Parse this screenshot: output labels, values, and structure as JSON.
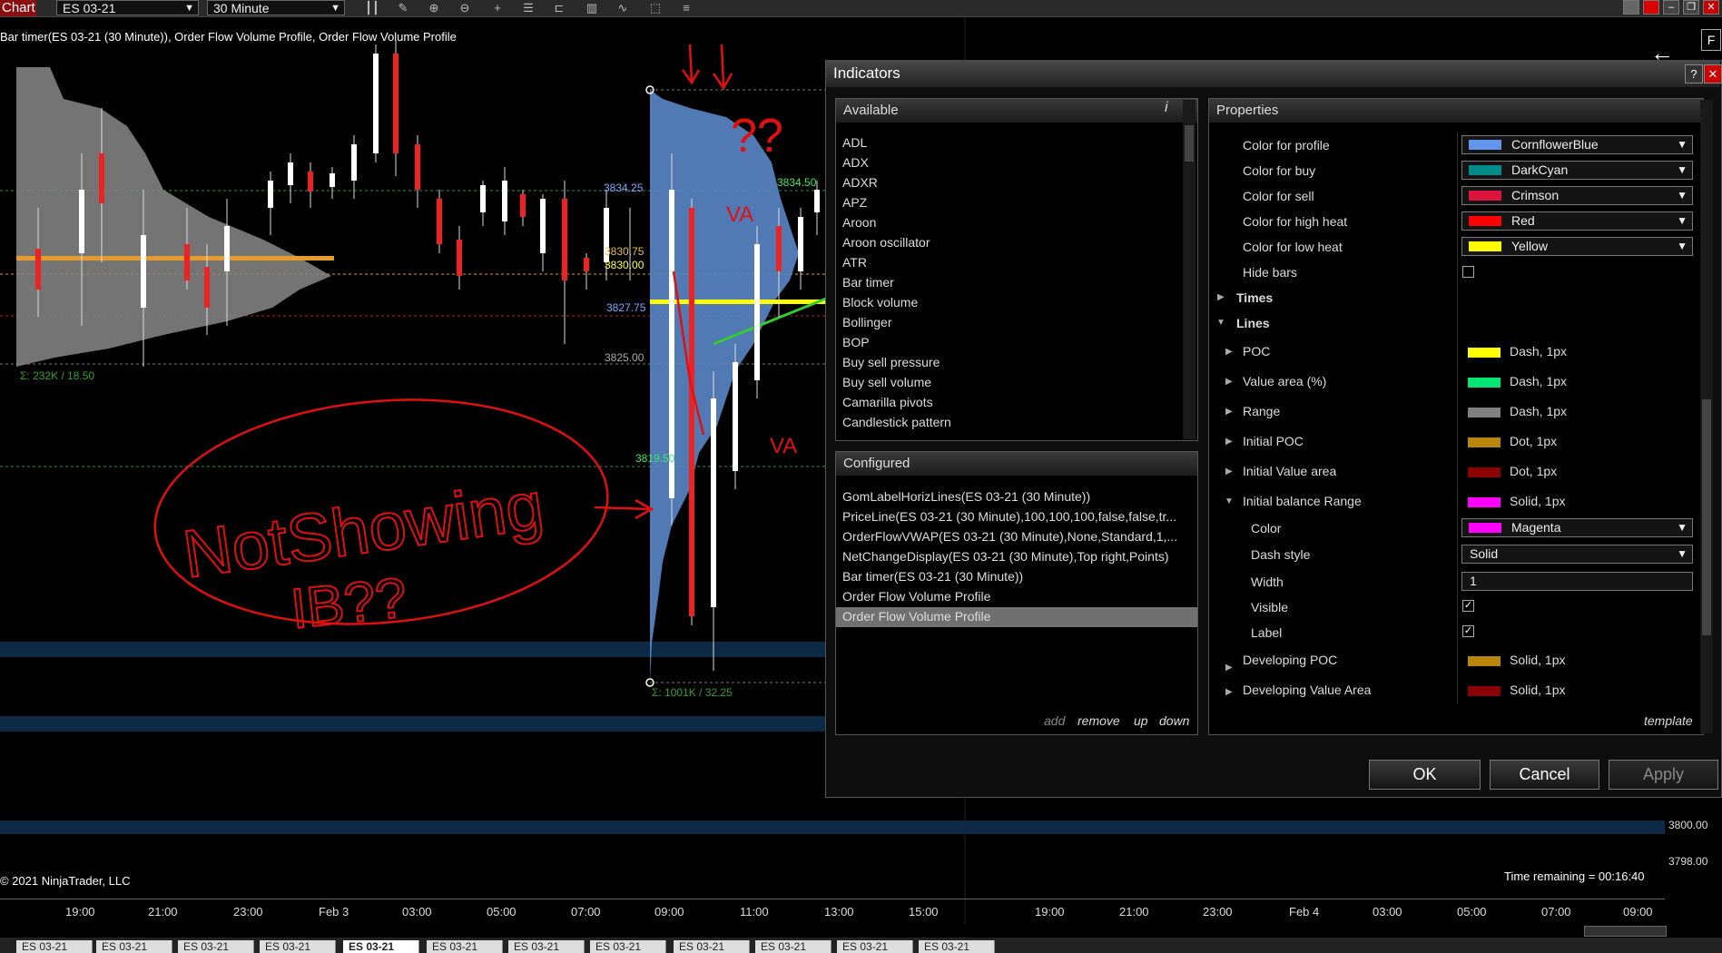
{
  "toolbar": {
    "chart_tab": "Chart",
    "instrument": "ES 03-21",
    "interval": "30 Minute"
  },
  "chart": {
    "title": "Bar timer(ES 03-21 (30 Minute)), Order Flow Volume Profile, Order Flow Volume Profile",
    "levels": {
      "l1": "3834.25",
      "l2": "3834.50",
      "l3": "3830.75",
      "l4": "3830.00",
      "l5": "3827.75",
      "l6": "3825.00",
      "l7": "3819.50"
    },
    "profile_stats_left": "Σ: 232K / 18.50",
    "profile_stats_right": "Σ: 1001K / 32.25",
    "y_ticks": [
      "3800.00",
      "3798.00"
    ],
    "x_ticks": [
      "19:00",
      "21:00",
      "23:00",
      "Feb 3",
      "03:00",
      "05:00",
      "07:00",
      "09:00",
      "11:00",
      "13:00",
      "15:00",
      "19:00",
      "21:00",
      "23:00",
      "Feb 4",
      "03:00",
      "05:00",
      "07:00",
      "09:00"
    ],
    "copyright": "© 2021 NinjaTrader, LLC",
    "time_remaining": "Time remaining = 00:16:40",
    "annotations": {
      "qq": "??",
      "va_top": "VA",
      "va_bottom": "VA",
      "not_showing": "NotShowing",
      "ib": "IB??"
    }
  },
  "dialog": {
    "title": "Indicators",
    "available_header": "Available",
    "available": [
      "ADL",
      "ADX",
      "ADXR",
      "APZ",
      "Aroon",
      "Aroon oscillator",
      "ATR",
      "Bar timer",
      "Block volume",
      "Bollinger",
      "BOP",
      "Buy sell pressure",
      "Buy sell volume",
      "Camarilla pivots",
      "Candlestick pattern"
    ],
    "configured_header": "Configured",
    "configured": [
      "GomLabelHorizLines(ES 03-21 (30 Minute))",
      "PriceLine(ES 03-21 (30 Minute),100,100,100,false,false,tr...",
      "OrderFlowVWAP(ES 03-21 (30 Minute),None,Standard,1,...",
      "NetChangeDisplay(ES 03-21 (30 Minute),Top right,Points)",
      "Bar timer(ES 03-21 (30 Minute))",
      "Order Flow Volume Profile",
      "Order Flow Volume Profile"
    ],
    "configured_links": {
      "add": "add",
      "remove": "remove",
      "up": "up",
      "down": "down"
    },
    "properties_header": "Properties",
    "colors": [
      {
        "label": "Color for profile",
        "value": "CornflowerBlue",
        "color": "#6495ED"
      },
      {
        "label": "Color for buy",
        "value": "DarkCyan",
        "color": "#008B8B"
      },
      {
        "label": "Color for sell",
        "value": "Crimson",
        "color": "#DC143C"
      },
      {
        "label": "Color for high heat",
        "value": "Red",
        "color": "#FF0000"
      },
      {
        "label": "Color for low heat",
        "value": "Yellow",
        "color": "#FFFF00"
      }
    ],
    "hide_bars": "Hide bars",
    "times": "Times",
    "lines": "Lines",
    "line_items": [
      {
        "label": "POC",
        "value": "Dash, 1px",
        "color": "#FFFF00"
      },
      {
        "label": "Value area (%)",
        "value": "Dash, 1px",
        "color": "#00E676"
      },
      {
        "label": "Range",
        "value": "Dash, 1px",
        "color": "#808080"
      },
      {
        "label": "Initial POC",
        "value": "Dot, 1px",
        "color": "#B8860B"
      },
      {
        "label": "Initial Value area",
        "value": "Dot, 1px",
        "color": "#8B0000"
      },
      {
        "label": "Initial balance Range",
        "value": "Solid, 1px",
        "color": "#FF00FF"
      }
    ],
    "ib_sub": {
      "color_label": "Color",
      "color_value": "Magenta",
      "color_hex": "#FF00FF",
      "dash_label": "Dash style",
      "dash_value": "Solid",
      "width_label": "Width",
      "width_value": "1",
      "visible_label": "Visible",
      "label_label": "Label"
    },
    "line_items_after": [
      {
        "label": "Developing POC",
        "value": "Solid, 1px",
        "color": "#B8860B"
      },
      {
        "label": "Developing Value Area",
        "value": "Solid, 1px",
        "color": "#8B0000"
      }
    ],
    "template_link": "template",
    "ok": "OK",
    "cancel": "Cancel",
    "apply": "Apply"
  }
}
